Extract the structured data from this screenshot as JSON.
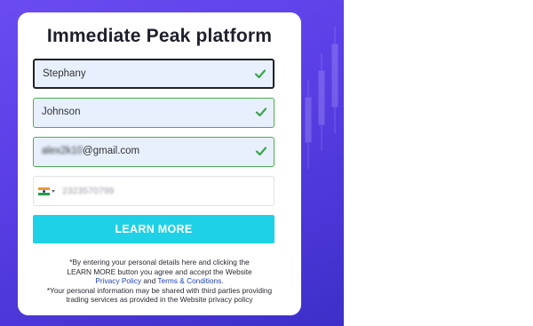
{
  "form": {
    "title": "Immediate Peak platform",
    "first_name": {
      "value": "Stephany",
      "state": "focused",
      "valid": true
    },
    "last_name": {
      "value": "Johnson",
      "state": "valid",
      "valid": true
    },
    "email": {
      "value_blurred": "alex2k10",
      "value_domain": "@gmail.com",
      "state": "valid",
      "valid": true
    },
    "phone": {
      "country_icon": "india-flag-icon",
      "value": "2323570799"
    },
    "submit_label": "LEARN MORE"
  },
  "disclaimer": {
    "line1": "*By entering your personal details here and clicking the",
    "line2": "LEARN MORE button you agree and accept the Website",
    "privacy_link": "Privacy Policy",
    "and_word": "and",
    "terms_link": "Terms & Conditions",
    "line3_end": ".",
    "line4": "*Your personal information may be shared with third parties providing",
    "line5": "trading services as provided in the Website privacy policy"
  },
  "colors": {
    "background_gradient_start": "#6a4cf0",
    "background_gradient_end": "#3d2fc8",
    "cta": "#1fd1e6",
    "valid_border": "#4caf50",
    "input_fill": "#e8f0fe",
    "link": "#1f3fb5"
  }
}
